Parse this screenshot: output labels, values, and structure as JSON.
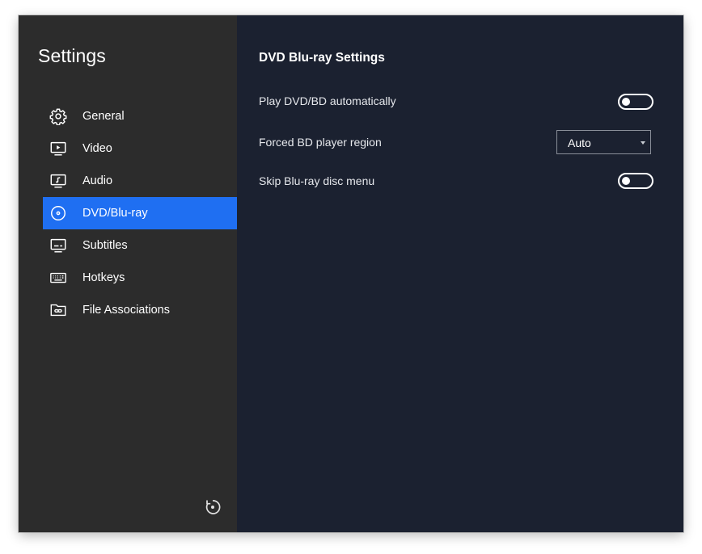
{
  "window": {
    "close_color": "#ee5a52"
  },
  "sidebar": {
    "title": "Settings",
    "items": [
      {
        "label": "General",
        "icon": "gear-icon",
        "active": false
      },
      {
        "label": "Video",
        "icon": "video-icon",
        "active": false
      },
      {
        "label": "Audio",
        "icon": "audio-icon",
        "active": false
      },
      {
        "label": "DVD/Blu-ray",
        "icon": "disc-icon",
        "active": true
      },
      {
        "label": "Subtitles",
        "icon": "subtitles-icon",
        "active": false
      },
      {
        "label": "Hotkeys",
        "icon": "keyboard-icon",
        "active": false
      },
      {
        "label": "File Associations",
        "icon": "folder-link-icon",
        "active": false
      }
    ],
    "reset_icon": "reset-icon"
  },
  "main": {
    "title": "DVD Blu-ray Settings",
    "play_auto": {
      "label": "Play DVD/BD automatically",
      "enabled": false
    },
    "forced_region": {
      "label": "Forced BD player region",
      "value": "Auto"
    },
    "skip_menu": {
      "label": "Skip Blu-ray disc menu",
      "enabled": false
    }
  },
  "colors": {
    "sidebar_bg": "#2c2c2c",
    "main_bg": "#1b2130",
    "accent": "#1f6ff2",
    "text": "#ffffff"
  }
}
